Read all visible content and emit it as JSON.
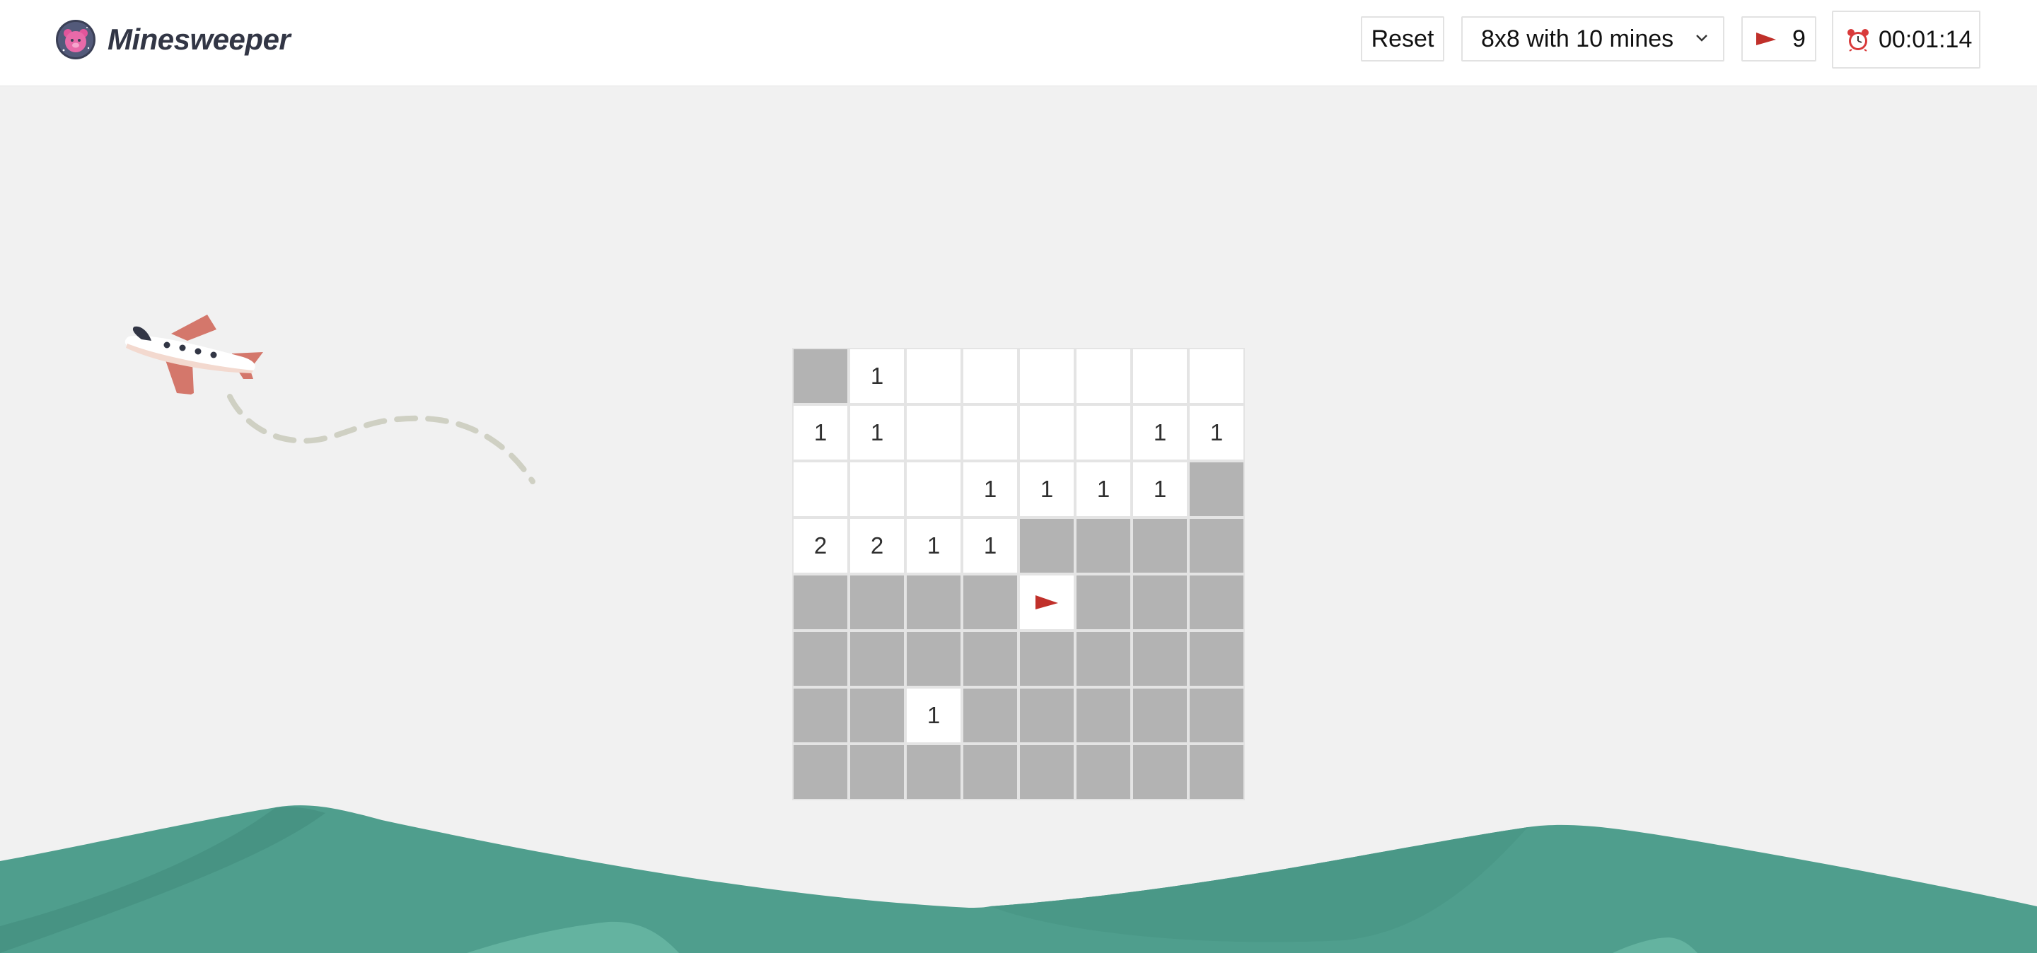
{
  "app": {
    "title": "Minesweeper",
    "logo_icon": "space-bear-logo-icon"
  },
  "toolbar": {
    "reset_label": "Reset",
    "difficulty_selected": "8x8 with 10 mines",
    "flags_icon": "flag-icon",
    "flags_count": "9",
    "timer_icon": "alarm-clock-icon",
    "timer_value": "00:01:14"
  },
  "colors": {
    "brand_text": "#323645",
    "flag": "#c0302a",
    "hidden_cell": "#b3b3b3",
    "revealed_cell": "#ffffff",
    "sea": "#4f9e8d",
    "background": "#f1f1f1"
  },
  "board": {
    "rows": 8,
    "cols": 8,
    "legend": {
      "H": "hidden",
      "_": "revealed-empty",
      "F": "flagged"
    },
    "cells": [
      [
        "H",
        "1",
        "_",
        "_",
        "_",
        "_",
        "_",
        "_"
      ],
      [
        "1",
        "1",
        "_",
        "_",
        "_",
        "_",
        "1",
        "1"
      ],
      [
        "_",
        "_",
        "_",
        "1",
        "1",
        "1",
        "1",
        "H"
      ],
      [
        "2",
        "2",
        "1",
        "1",
        "H",
        "H",
        "H",
        "H"
      ],
      [
        "H",
        "H",
        "H",
        "H",
        "F",
        "H",
        "H",
        "H"
      ],
      [
        "H",
        "H",
        "H",
        "H",
        "H",
        "H",
        "H",
        "H"
      ],
      [
        "H",
        "H",
        "1",
        "H",
        "H",
        "H",
        "H",
        "H"
      ],
      [
        "H",
        "H",
        "H",
        "H",
        "H",
        "H",
        "H",
        "H"
      ]
    ]
  },
  "decorations": {
    "plane": "airplane-illustration",
    "sea": "sea-waves-illustration"
  }
}
